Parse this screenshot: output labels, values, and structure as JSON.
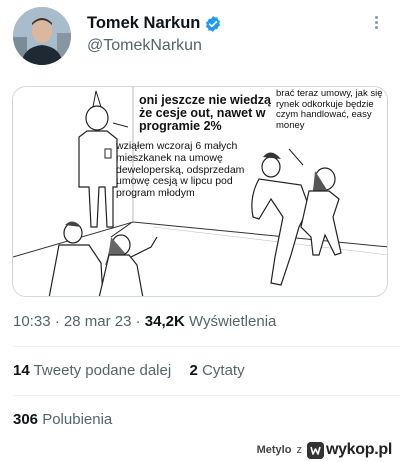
{
  "tweet": {
    "display_name": "Tomek Narkun",
    "handle": "@TomekNarkun",
    "meme": {
      "top_text": "oni jeszcze nie wiedzą że cesje out, nawet w programie 2%",
      "right_text": "brać teraz umowy, jak się rynek odkorkuje będzie czym handlować, easy money",
      "middle_text": "wziąłem wczoraj 6 małych mieszkanek na umowę deweloperską, odsprzedam umowę cesją w lipcu pod program młodym"
    },
    "time": "10:33",
    "date": "28 mar 23",
    "views_count": "34,2K",
    "views_label": "Wyświetlenia",
    "retweets_count": "14",
    "retweets_label": "Tweety podane dalej",
    "quotes_count": "2",
    "quotes_label": "Cytaty",
    "likes_count": "306",
    "likes_label": "Polubienia"
  },
  "watermark": {
    "user": "Metylo",
    "sep": "z",
    "site": "wykop.pl"
  },
  "colors": {
    "verified": "#1d9bf0",
    "secondary_text": "#536471",
    "primary_text": "#0f1419"
  },
  "icons": {
    "verified": "verified-badge-icon",
    "more": "more-options-icon"
  }
}
